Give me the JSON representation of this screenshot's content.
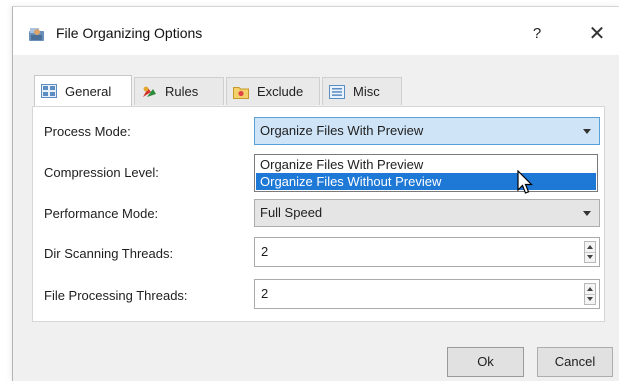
{
  "window": {
    "title": "File Organizing Options",
    "help_label": "?",
    "close_label": "✕"
  },
  "tabs": [
    {
      "label": "General",
      "icon": "general-grid-icon",
      "active": true
    },
    {
      "label": "Rules",
      "icon": "rules-icon",
      "active": false
    },
    {
      "label": "Exclude",
      "icon": "exclude-folder-icon",
      "active": false
    },
    {
      "label": "Misc",
      "icon": "misc-list-icon",
      "active": false
    }
  ],
  "form": {
    "process_mode": {
      "label": "Process Mode:",
      "value": "Organize Files With Preview",
      "options": [
        "Organize Files With Preview",
        "Organize Files Without Preview"
      ],
      "highlighted_option": "Organize Files Without Preview"
    },
    "compression_level": {
      "label": "Compression Level:"
    },
    "performance_mode": {
      "label": "Performance Mode:",
      "value": "Full Speed"
    },
    "dir_scanning_threads": {
      "label": "Dir Scanning Threads:",
      "value": "2"
    },
    "file_processing_threads": {
      "label": "File Processing Threads:",
      "value": "2"
    }
  },
  "buttons": {
    "ok": "Ok",
    "cancel": "Cancel"
  },
  "colors": {
    "selection": "#1e78d6",
    "focus_border": "#5aa0d8",
    "combo_focus_bg": "#cfe4f7"
  }
}
